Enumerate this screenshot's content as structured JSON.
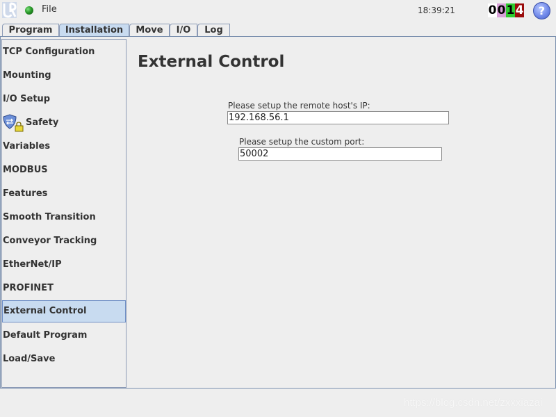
{
  "topbar": {
    "logo_icon": "ur-logo-icon",
    "status_icon": "green-globe-icon",
    "file_menu": "File",
    "clock": "18:39:21",
    "counter_digits": [
      "0",
      "0",
      "1",
      "4"
    ],
    "counter_colors": [
      "#ffffff",
      "#d7a0d7",
      "#2fcb2f",
      "#9a0b0b"
    ],
    "help_label": "?"
  },
  "tabs": [
    {
      "label": "Program",
      "active": false
    },
    {
      "label": "Installation",
      "active": true
    },
    {
      "label": "Move",
      "active": false
    },
    {
      "label": "I/O",
      "active": false
    },
    {
      "label": "Log",
      "active": false
    }
  ],
  "sidebar": {
    "items": [
      {
        "label": "TCP Configuration"
      },
      {
        "label": "Mounting"
      },
      {
        "label": "I/O Setup"
      },
      {
        "label": "Safety",
        "icon": "safety-shield-lock-icon"
      },
      {
        "label": "Variables"
      },
      {
        "label": "MODBUS"
      },
      {
        "label": "Features"
      },
      {
        "label": "Smooth Transition"
      },
      {
        "label": "Conveyor Tracking"
      },
      {
        "label": "EtherNet/IP"
      },
      {
        "label": "PROFINET"
      },
      {
        "label": "External Control",
        "active": true
      },
      {
        "label": "Default Program"
      },
      {
        "label": "Load/Save"
      }
    ]
  },
  "main": {
    "title": "External Control",
    "host_ip_label": "Please setup the remote host's IP:",
    "host_ip_value": "192.168.56.1",
    "port_label": "Please setup the custom port:",
    "port_value": "50002"
  },
  "watermark": "https://blog.csdn.net/zxxxiazai",
  "colors": {
    "active_bg": "#c8dbf0",
    "border": "#8b9ab5",
    "background": "#eeeeee"
  }
}
